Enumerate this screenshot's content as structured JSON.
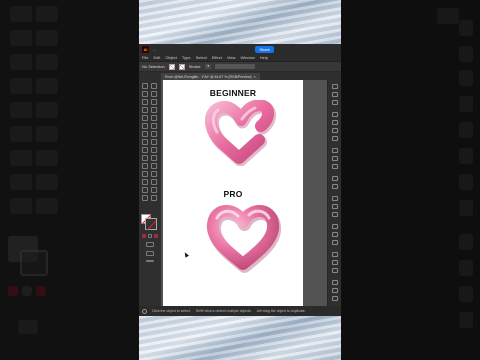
{
  "app": {
    "logo_text": "Ai",
    "share_label": "Share",
    "title_mini": "...",
    "menus": [
      "File",
      "Edit",
      "Object",
      "Type",
      "Select",
      "Effect",
      "View",
      "Window",
      "Help"
    ],
    "control": {
      "selection_label": "No Selection",
      "stroke_label": "Stroke:"
    },
    "doc_tab": "Prom @NeUTorngfile - 1*Ai* @ 64.67 % (RGB/Preview)",
    "status": {
      "hint1": "Click the object to select.",
      "hint2": "Shift+click to select multiple objects.",
      "hint3": "Alt+drag the object to duplicate."
    },
    "zoom": "66.88%"
  },
  "artboard": {
    "heading_top": "BEGINNER",
    "heading_bottom": "PRO"
  },
  "colors": {
    "heart_light": "#f7a9c9",
    "heart_mid": "#e86a9e",
    "heart_dark": "#c4467b",
    "accent_blue": "#1473e6"
  },
  "icons": [
    "selection-tool-icon",
    "direct-selection-icon",
    "pen-tool-icon",
    "type-tool-icon",
    "rectangle-tool-icon",
    "brush-tool-icon",
    "eraser-tool-icon",
    "rotate-tool-icon",
    "scale-tool-icon",
    "width-tool-icon",
    "shape-builder-icon",
    "gradient-tool-icon",
    "eyedropper-icon",
    "blend-tool-icon",
    "symbol-sprayer-icon",
    "graph-tool-icon",
    "artboard-tool-icon",
    "hand-tool-icon",
    "zoom-tool-icon"
  ]
}
